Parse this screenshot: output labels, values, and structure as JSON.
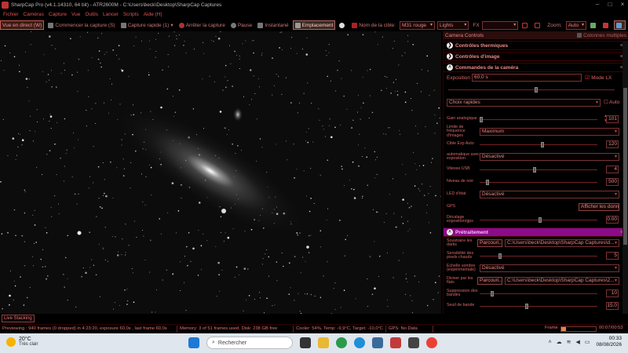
{
  "window": {
    "title": "SharpCap Pro (v4.1.14310, 64 bit) - ATR2600M - C:\\Users\\beck\\Desktop\\SharpCap Captures"
  },
  "menu": [
    "Fichier",
    "Caméras",
    "Capture",
    "Vue",
    "Outils",
    "Lancer",
    "Scripts",
    "Aide (H)"
  ],
  "toolbar": {
    "live_view": "Vue en direct (W)",
    "start_capture": "Commencer la capture (S)",
    "quick_capture": "Capture rapide (1)",
    "stop_capture": "Arrêter la capture",
    "pause": "Pause",
    "snapshot": "Instantané",
    "placement": "Emplacement",
    "target_label": "Nom de la cible:",
    "target_value": "M31 rouge",
    "frame_type": "Lights",
    "fx_label": "FX",
    "zoom_label": "Zoom:",
    "zoom_value": "Auto"
  },
  "live_stacking": "Live Stacking",
  "panel": {
    "title": "Camera Controls",
    "multi_columns": "Colonnes multiples",
    "sections": {
      "thermal": "Contrôles thermiques",
      "image": "Contrôles d'image",
      "camera": "Commandes de la caméra",
      "preprocessing": "Prétraitement"
    },
    "exposure": {
      "label": "Exposition",
      "value": "60,0 s",
      "lx_label": "Mode LX"
    },
    "quick_pick": {
      "label": "Choix rapides",
      "auto": "Auto"
    },
    "gain": {
      "label": "Gain analogique",
      "value": "101"
    },
    "fps_limit": {
      "label": "Limite de fréquence d'images",
      "value": "Maximum"
    },
    "target_auto": {
      "label": "Cible Exp Auto",
      "value": "120"
    },
    "auto_gain_exp": {
      "label": "automatique avec exposition",
      "value": "Désactivé"
    },
    "usb_speed": {
      "label": "Vitesse USB",
      "value": "4"
    },
    "black_level": {
      "label": "Niveau de noir",
      "value": "500"
    },
    "led": {
      "label": "LED d'état",
      "value": "Désactivé"
    },
    "gps": {
      "label": "GPS",
      "button": "Afficher les donn"
    },
    "exp_offset": {
      "label": "Décalage exposition/gps",
      "value": "0.00"
    },
    "subtract_darks": {
      "label": "Soustraire les darks",
      "button": "Parcouri...",
      "path": "C:\\Users\\beck\\Desktop\\SharpCap Captures\\d..."
    },
    "hot_pixel": {
      "label": "Sensibilité des pixels chauds",
      "value": "5"
    },
    "dark_scale": {
      "label": "Echelle sombre (expérimentale)",
      "value": "Désactivé"
    },
    "divide_flats": {
      "label": "Diviser par les flats",
      "button": "Parcouri...",
      "path": "C:\\Users\\beck\\Desktop\\SharpCap Captures\\2..."
    },
    "banding_supp": {
      "label": "Suppression des bandes",
      "value": "10"
    },
    "banding_thresh": {
      "label": "Seuil de bande",
      "value": "15.0"
    }
  },
  "status": {
    "previewing": "Previewing : 940 frames (0 dropped) in 4:23:20, exposure 60,0s , last frame 60,0s",
    "memory": "Memory: 3 of 51 frames used, Disk: 238 GB free",
    "cooler": "Cooler: 54%, Temp: -9,9°C, Target: -10,0°C",
    "gps": "GPS: No Data",
    "frame_label": "Frame",
    "frame_time": "00:07/00:53",
    "frame_progress": 0.13
  },
  "taskbar": {
    "temperature": "20°C",
    "weather": "Très clair",
    "search": "Rechercher",
    "time": "00:33",
    "date": "08/08/2026"
  }
}
